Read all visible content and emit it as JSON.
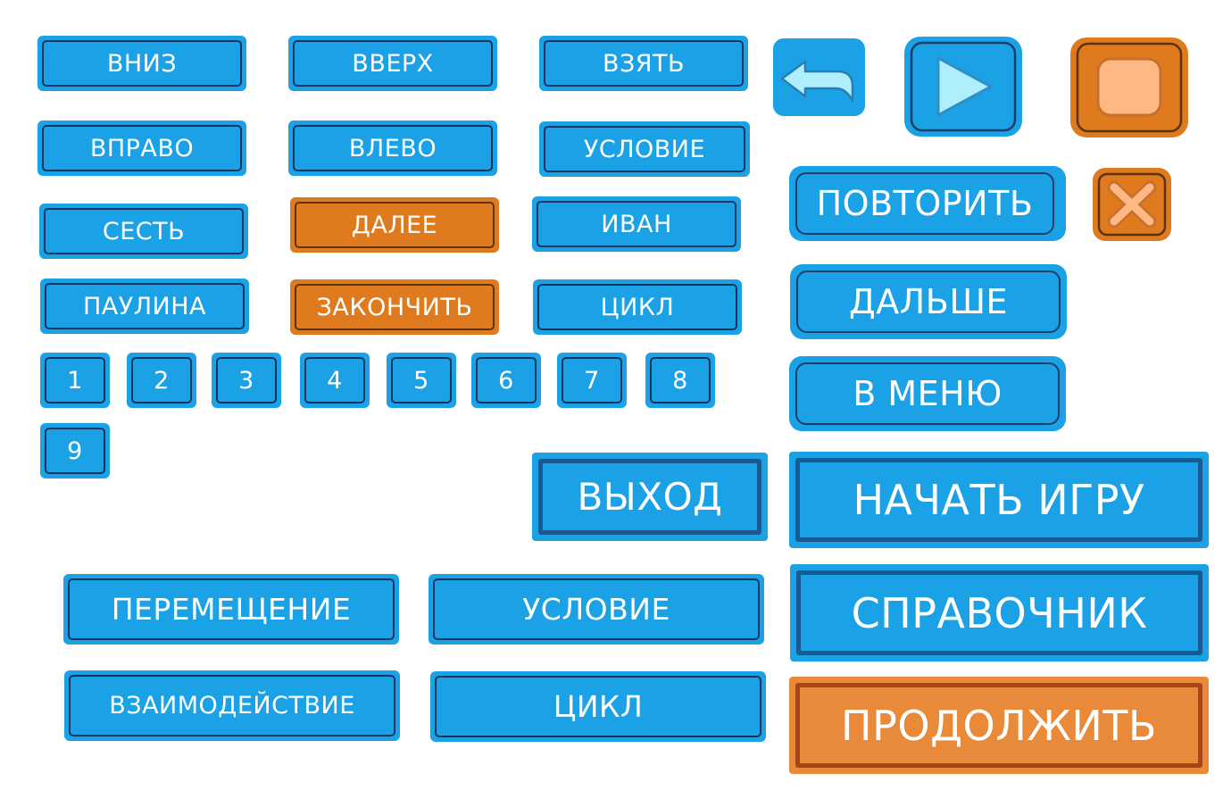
{
  "colors": {
    "blue": "#1aa1e6",
    "orange": "#e07a1f",
    "outline": "#16365f",
    "light_blue_icon": "#aeeefd",
    "peach": "#ffb883"
  },
  "small_buttons": {
    "down": "ВНИЗ",
    "up": "ВВЕРХ",
    "take": "ВЗЯТЬ",
    "right": "ВПРАВО",
    "left": "ВЛЕВО",
    "condition": "УСЛОВИЕ",
    "sit": "СЕСТЬ",
    "next": "ДАЛЕЕ",
    "ivan": "ИВАН",
    "paulina": "ПАУЛИНА",
    "finish": "ЗАКОНЧИТЬ",
    "loop": "ЦИКЛ"
  },
  "numbers": [
    "1",
    "2",
    "3",
    "4",
    "5",
    "6",
    "7",
    "8",
    "9"
  ],
  "icons": {
    "back": "back-arrow-icon",
    "play": "play-icon",
    "stop": "stop-icon",
    "close": "close-icon"
  },
  "menu": {
    "repeat": "ПОВТОРИТЬ",
    "further": "ДАЛЬШЕ",
    "to_menu": "В МЕНЮ",
    "exit": "ВЫХОД",
    "start_game": "НАЧАТЬ ИГРУ",
    "reference": "СПРАВОЧНИК",
    "continue": "ПРОДОЛЖИТЬ"
  },
  "categories": {
    "movement": "ПЕРЕМЕЩЕНИЕ",
    "condition": "УСЛОВИЕ",
    "interaction": "ВЗАИМОДЕЙСТВИЕ",
    "loop": "ЦИКЛ"
  }
}
